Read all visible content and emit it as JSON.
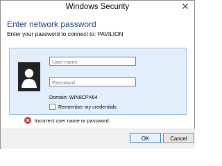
{
  "window": {
    "title": "Windows Security"
  },
  "header": {
    "title": "Enter network password",
    "subtitle": "Enter your password to connect to: PAVILION"
  },
  "credentials": {
    "username_placeholder": "User name",
    "password_placeholder": "Password",
    "domain_text": "Domain: WIN8CPX64",
    "remember_label": "Remember my credentials",
    "remember_checked": false
  },
  "error": {
    "message": "Incorrect user name or password."
  },
  "buttons": {
    "ok_label": "OK",
    "cancel_label": "Cancel"
  },
  "colors": {
    "title_blue": "#1e3f8e",
    "tile_bg": "#e3eefb",
    "tile_border": "#9ec0e8",
    "error_red": "#d63c3c"
  },
  "icons": {
    "close": "close-icon",
    "avatar": "user-avatar-icon",
    "error": "error-icon"
  }
}
